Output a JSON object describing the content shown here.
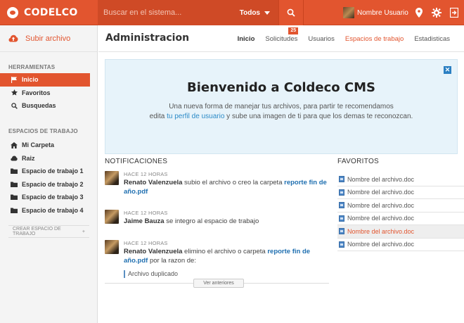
{
  "brand": {
    "name": "CODELCO"
  },
  "search": {
    "placeholder": "Buscar en el sistema...",
    "scope": "Todos"
  },
  "user": {
    "name": "Nombre Usuario"
  },
  "sidebar": {
    "upload_label": "Subir archivo",
    "tools_title": "HERRAMIENTAS",
    "tools": [
      {
        "label": "Inicio",
        "icon": "flag-icon"
      },
      {
        "label": "Favoritos",
        "icon": "star-icon"
      },
      {
        "label": "Busquedas",
        "icon": "search-icon"
      }
    ],
    "workspaces_title": "ESPACIOS DE TRABAJO",
    "workspaces": [
      {
        "label": "Mi Carpeta",
        "icon": "home-icon"
      },
      {
        "label": "Raiz",
        "icon": "cloud-icon"
      },
      {
        "label": "Espacio de trabajo 1",
        "icon": "folder-icon"
      },
      {
        "label": "Espacio de trabajo 2",
        "icon": "folder-icon"
      },
      {
        "label": "Espacio de trabajo 3",
        "icon": "folder-icon"
      },
      {
        "label": "Espacio de trabajo 4",
        "icon": "folder-icon"
      }
    ],
    "create_label": "CREAR ESPACIO DE TRABAJO",
    "create_symbol": "+"
  },
  "header": {
    "title": "Administracion",
    "tabs": [
      "Inicio",
      "Solicitudes",
      "Usuarios",
      "Espacios de trabajo",
      "Estadisticas"
    ],
    "badge": "25"
  },
  "welcome": {
    "title": "Bienvenido a Coldeco CMS",
    "line1": "Una nueva forma de manejar tus archivos, para partir te recomendamos",
    "line2_pre": "edita ",
    "line2_link": "tu perfil de usuario",
    "line2_post": " y sube una imagen de ti para que los demas te reconozcan.",
    "close": "✕"
  },
  "notifications": {
    "title": "NOTIFICACIONES",
    "items": [
      {
        "time": "HACE 12 HORAS",
        "user": "Renato Valenzuela",
        "text": " subio el archivo o creo la carpeta ",
        "link": "reporte fin de año.pdf"
      },
      {
        "time": "HACE 12 HORAS",
        "user": "Jaime Bauza",
        "text": " se integro al espacio de trabajo"
      },
      {
        "time": "HACE 12 HORAS",
        "user": "Renato Valenzuela",
        "text": " elimino el archivo o carpeta ",
        "link": "reporte fin de año.pdf",
        "text2": " por la razon de:",
        "reason": "Archivo duplicado"
      }
    ],
    "older_label": "Ver anteriores"
  },
  "favorites": {
    "title": "FAVORITOS",
    "items": [
      "Nombre del archivo.doc",
      "Nombre del archivo.doc",
      "Nombre del archivo.doc",
      "Nombre del archivo.doc",
      "Nombre del archivo.doc",
      "Nombre del archivo.doc"
    ],
    "highlight_color": "#e2552f"
  },
  "colors": {
    "accent": "#e2552f",
    "link": "#1f6fb0",
    "welcome_bg": "#e7f3fa"
  }
}
